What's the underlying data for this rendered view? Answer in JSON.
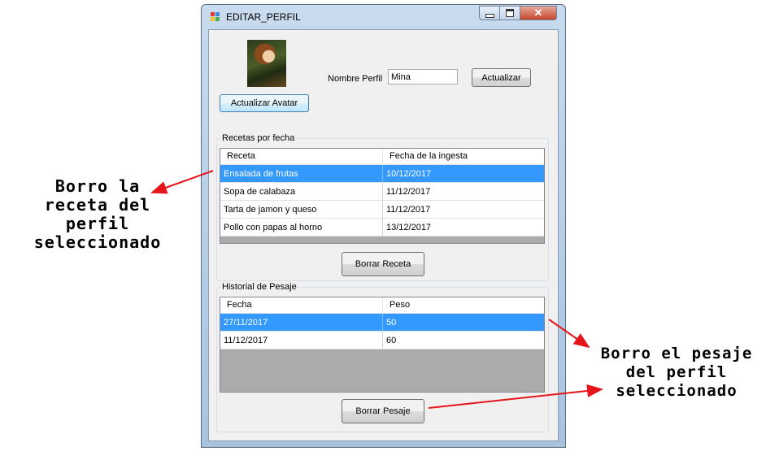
{
  "window": {
    "title": "EDITAR_PERFIL",
    "close_glyph": "✕"
  },
  "profile": {
    "name_label": "Nombre Perfil",
    "name_value": "Mina",
    "update_button": "Actualizar",
    "update_avatar_button": "Actualizar Avatar"
  },
  "recipes": {
    "group_title": "Recetas por fecha",
    "columns": [
      "Receta",
      "Fecha de la ingesta"
    ],
    "rows": [
      [
        "Ensalada de frutas",
        "10/12/2017"
      ],
      [
        "Sopa de calabaza",
        "11/12/2017"
      ],
      [
        "Tarta de jamon y queso",
        "11/12/2017"
      ],
      [
        "Pollo con papas al horno",
        "13/12/2017"
      ]
    ],
    "selected_index": 0,
    "delete_button": "Borrar Receta"
  },
  "weights": {
    "group_title": "Historial de Pesaje",
    "columns": [
      "Fecha",
      "Peso"
    ],
    "rows": [
      [
        "27/11/2017",
        "50"
      ],
      [
        "11/12/2017",
        "60"
      ]
    ],
    "selected_index": 0,
    "delete_button": "Borrar Pesaje"
  },
  "annotations": {
    "recipe_note": [
      "Borro la",
      "receta del",
      "perfil",
      "seleccionado"
    ],
    "weight_note": [
      "Borro el pesaje",
      "del perfil",
      "seleccionado"
    ],
    "arrow_color": "#e8141c"
  },
  "colors": {
    "selection": "#3399ff",
    "listview_empty": "#ababab"
  }
}
